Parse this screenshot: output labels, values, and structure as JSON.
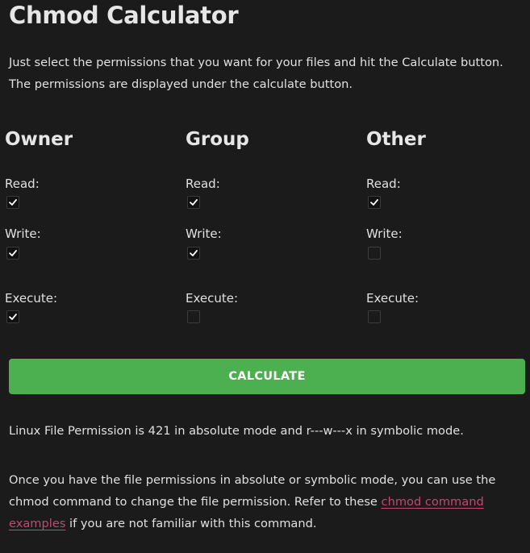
{
  "page": {
    "title": "Chmod Calculator",
    "intro_line1": "Just select the permissions that you want for your files and hit the Calculate button.",
    "intro_line2": "The permissions are displayed under the calculate button."
  },
  "permissions": {
    "owner": {
      "heading": "Owner",
      "read_label": "Read:",
      "read_checked": true,
      "write_label": "Write:",
      "write_checked": true,
      "execute_label": "Execute:",
      "execute_checked": true
    },
    "group": {
      "heading": "Group",
      "read_label": "Read:",
      "read_checked": true,
      "write_label": "Write:",
      "write_checked": true,
      "execute_label": "Execute:",
      "execute_checked": false
    },
    "other": {
      "heading": "Other",
      "read_label": "Read:",
      "read_checked": true,
      "write_label": "Write:",
      "write_checked": false,
      "execute_label": "Execute:",
      "execute_checked": false
    }
  },
  "calculate_button": {
    "label": "CALCULATE",
    "color": "#4caf50"
  },
  "result": {
    "text": "Linux File Permission is 421 in absolute mode and r---w---x in symbolic mode."
  },
  "outro": {
    "line1": "Once you have the file permissions in absolute or symbolic mode, you can use the",
    "line2_before": "chmod command to change the file permission. Refer to these ",
    "link_part1": "chmod command",
    "link_part2": "examples",
    "line3_after": " if you are not familiar with this command.",
    "link_color": "#c04a70"
  }
}
